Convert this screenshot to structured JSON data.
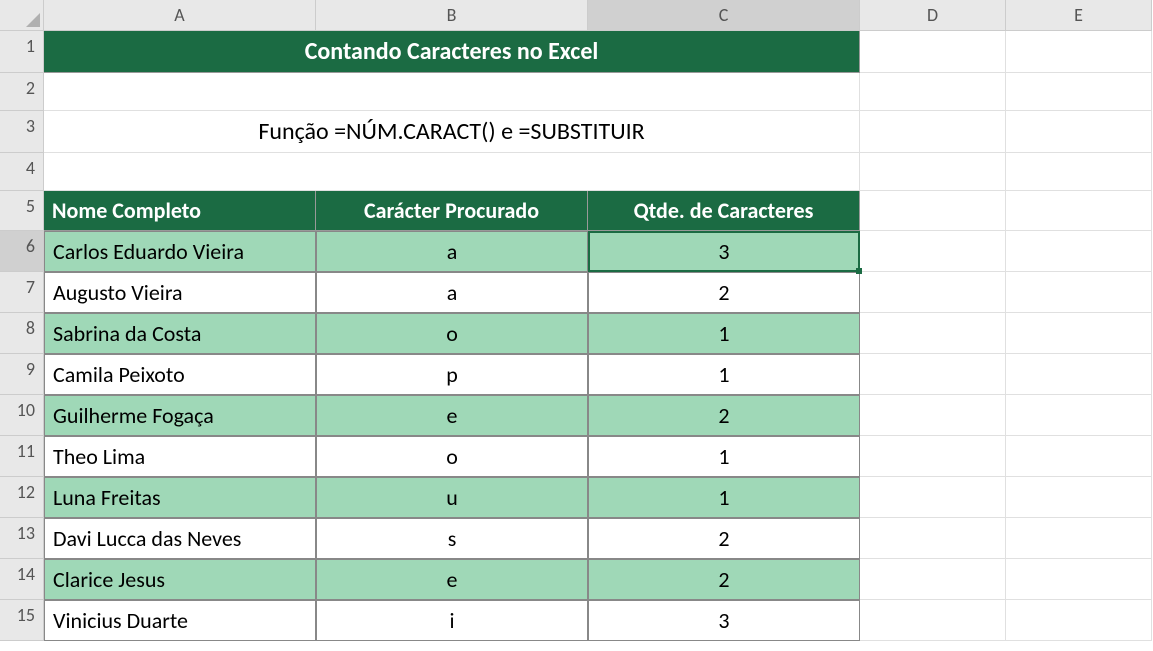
{
  "columns": [
    "A",
    "B",
    "C",
    "D",
    "E"
  ],
  "rows": [
    "1",
    "2",
    "3",
    "4",
    "5",
    "6",
    "7",
    "8",
    "9",
    "10",
    "11",
    "12",
    "13",
    "14",
    "15"
  ],
  "selected_col": "C",
  "selected_row": "6",
  "title": "Contando Caracteres no Excel",
  "subtitle": "Função =NÚM.CARACT() e =SUBSTITUIR",
  "headers": {
    "a": "Nome Completo",
    "b": "Carácter Procurado",
    "c": "Qtde. de Caracteres"
  },
  "data": [
    {
      "name": "Carlos Eduardo Vieira",
      "char": "a",
      "count": "3"
    },
    {
      "name": "Augusto Vieira",
      "char": "a",
      "count": "2"
    },
    {
      "name": "Sabrina da Costa",
      "char": "o",
      "count": "1"
    },
    {
      "name": "Camila Peixoto",
      "char": "p",
      "count": "1"
    },
    {
      "name": "Guilherme Fogaça",
      "char": "e",
      "count": "2"
    },
    {
      "name": "Theo Lima",
      "char": "o",
      "count": "1"
    },
    {
      "name": "Luna Freitas",
      "char": "u",
      "count": "1"
    },
    {
      "name": "Davi Lucca das Neves",
      "char": "s",
      "count": "2"
    },
    {
      "name": "Clarice Jesus",
      "char": "e",
      "count": "2"
    },
    {
      "name": "Vinicius Duarte",
      "char": "i",
      "count": "3"
    }
  ]
}
